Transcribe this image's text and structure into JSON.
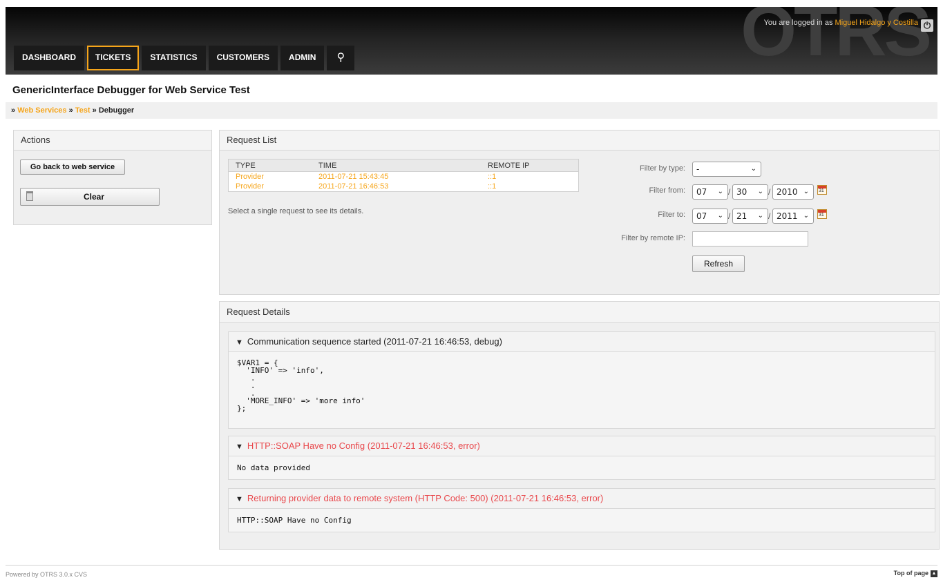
{
  "header": {
    "logo": "OTRS",
    "login_prefix": "You are logged in as",
    "user_name": "Miguel Hidalgo y Costilla",
    "logout_icon": "power-icon"
  },
  "nav": [
    {
      "label": "DASHBOARD",
      "active": false
    },
    {
      "label": "TICKETS",
      "active": true
    },
    {
      "label": "STATISTICS",
      "active": false
    },
    {
      "label": "CUSTOMERS",
      "active": false
    },
    {
      "label": "ADMIN",
      "active": false
    }
  ],
  "nav_search_icon": "search-icon",
  "page_title": "GenericInterface Debugger for Web Service Test",
  "breadcrumb": {
    "sep": "»",
    "items": [
      "Web Services",
      "Test",
      "Debugger"
    ]
  },
  "actions": {
    "title": "Actions",
    "back_button": "Go back to web service",
    "clear_button": "Clear",
    "clear_icon": "trash-icon"
  },
  "request_list": {
    "title": "Request List",
    "columns": [
      "TYPE",
      "TIME",
      "REMOTE IP"
    ],
    "rows": [
      {
        "type": "Provider",
        "time": "2011-07-21 15:43:45",
        "ip": "::1"
      },
      {
        "type": "Provider",
        "time": "2011-07-21 16:46:53",
        "ip": "::1"
      }
    ],
    "hint": "Select a single request to see its details."
  },
  "filters": {
    "type_label": "Filter by type:",
    "type_value": "-",
    "from_label": "Filter from:",
    "from_month": "07",
    "from_day": "30",
    "from_year": "2010",
    "to_label": "Filter to:",
    "to_month": "07",
    "to_day": "21",
    "to_year": "2011",
    "ip_label": "Filter by remote IP:",
    "ip_value": "",
    "refresh_button": "Refresh",
    "date_separator": "/",
    "calendar_day": "31"
  },
  "request_details": {
    "title": "Request Details",
    "entries": [
      {
        "summary": "Communication sequence started (2011-07-21 16:46:53, debug)",
        "is_error": false,
        "data": "$VAR1 = {\n  'INFO' => 'info',\n   .\n   .\n   .\n  'MORE_INFO' => 'more info'\n};"
      },
      {
        "summary": "HTTP::SOAP Have no Config (2011-07-21 16:46:53, error)",
        "is_error": true,
        "data": "No data provided"
      },
      {
        "summary": "Returning provider data to remote system (HTTP Code: 500) (2011-07-21 16:46:53, error)",
        "is_error": true,
        "data": "HTTP::SOAP Have no Config"
      }
    ]
  },
  "footer": {
    "powered_by": "Powered by OTRS 3.0.x CVS",
    "top_of_page": "Top of page"
  },
  "colors": {
    "accent": "#f6a51a",
    "error": "#e9484c",
    "header_bg": "#222222"
  }
}
